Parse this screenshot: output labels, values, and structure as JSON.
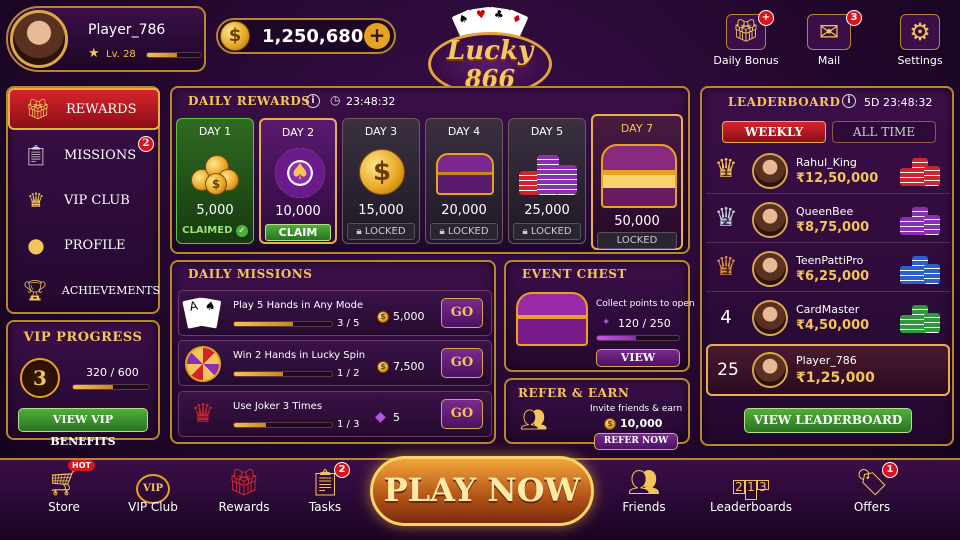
{
  "player": {
    "name": "Player_786",
    "level": "Lv. 28",
    "level_progress": 0.55
  },
  "balance": {
    "amount": "1,250,680",
    "add_label": "+"
  },
  "logo": {
    "line1": "Lucky",
    "line2": "866"
  },
  "top_actions": [
    {
      "label": "Daily Bonus",
      "icon": "gift-icon",
      "badge": "+"
    },
    {
      "label": "Mail",
      "icon": "mail-icon",
      "badge": "3"
    },
    {
      "label": "Settings",
      "icon": "gear-icon",
      "badge": ""
    }
  ],
  "sidebar": {
    "items": [
      {
        "label": "REWARDS",
        "icon": "gift-icon",
        "active": true,
        "badge": ""
      },
      {
        "label": "MISSIONS",
        "icon": "clipboard-icon",
        "active": false,
        "badge": "2"
      },
      {
        "label": "VIP CLUB",
        "icon": "crown-icon",
        "active": false,
        "badge": ""
      },
      {
        "label": "PROFILE",
        "icon": "person-icon",
        "active": false,
        "badge": ""
      },
      {
        "label": "ACHIEVEMENTS",
        "icon": "trophy-icon",
        "active": false,
        "badge": ""
      }
    ]
  },
  "vip": {
    "title": "VIP PROGRESS",
    "level": "3",
    "progress_text": "320 / 600",
    "progress": 0.53,
    "button": "VIEW VIP BENEFITS"
  },
  "daily_rewards": {
    "title": "DAILY REWARDS",
    "timer": "23:48:32",
    "days": [
      {
        "label": "DAY 1",
        "amount": "5,000",
        "status": "CLAIMED",
        "state": "claimed"
      },
      {
        "label": "DAY 2",
        "amount": "10,000",
        "status": "CLAIM",
        "state": "claim"
      },
      {
        "label": "DAY 3",
        "amount": "15,000",
        "status": "LOCKED",
        "state": "locked"
      },
      {
        "label": "DAY 4",
        "amount": "20,000",
        "status": "LOCKED",
        "state": "locked"
      },
      {
        "label": "DAY 5",
        "amount": "25,000",
        "status": "LOCKED",
        "state": "locked"
      },
      {
        "label": "DAY 7",
        "amount": "50,000",
        "status": "LOCKED",
        "state": "big"
      }
    ]
  },
  "daily_missions": {
    "title": "DAILY MISSIONS",
    "items": [
      {
        "title": "Play 5 Hands in Any Mode",
        "progress": "3 / 5",
        "progress_frac": 0.6,
        "reward": "5,000",
        "reward_type": "coin",
        "button": "GO"
      },
      {
        "title": "Win 2 Hands in Lucky Spin",
        "progress": "1 / 2",
        "progress_frac": 0.5,
        "reward": "7,500",
        "reward_type": "coin",
        "button": "GO"
      },
      {
        "title": "Use Joker 3 Times",
        "progress": "1 / 3",
        "progress_frac": 0.33,
        "reward": "5",
        "reward_type": "gem",
        "button": "GO"
      }
    ]
  },
  "event_chest": {
    "title": "EVENT CHEST",
    "desc": "Collect points to open",
    "progress_text": "120 / 250",
    "progress": 0.48,
    "button": "VIEW"
  },
  "refer": {
    "title": "REFER & EARN",
    "desc": "Invite friends & earn",
    "reward": "10,000",
    "button": "REFER NOW"
  },
  "leaderboard": {
    "title": "LEADERBOARD",
    "timer": "5D 23:48:32",
    "tabs": [
      "WEEKLY",
      "ALL TIME"
    ],
    "rows": [
      {
        "rank": "1",
        "name": "Rahul_King",
        "amount": "₹12,50,000",
        "chip_color": "#d0242c"
      },
      {
        "rank": "2",
        "name": "QueenBee",
        "amount": "₹8,75,000",
        "chip_color": "#8a2fb0"
      },
      {
        "rank": "3",
        "name": "TeenPattiPro",
        "amount": "₹6,25,000",
        "chip_color": "#2a5fd0"
      },
      {
        "rank": "4",
        "name": "CardMaster",
        "amount": "₹4,50,000",
        "chip_color": "#2f9a3a"
      }
    ],
    "me": {
      "rank": "25",
      "name": "Player_786",
      "amount": "₹1,25,000"
    },
    "button": "VIEW LEADERBOARD"
  },
  "bottom_nav": {
    "items": [
      {
        "label": "Store",
        "icon": "cart-icon",
        "badge": "HOT"
      },
      {
        "label": "VIP Club",
        "icon": "vip-icon",
        "badge": ""
      },
      {
        "label": "Rewards",
        "icon": "gift-icon",
        "badge": ""
      },
      {
        "label": "Tasks",
        "icon": "tasks-icon",
        "badge": "2"
      },
      {
        "label": "Friends",
        "icon": "friends-icon",
        "badge": ""
      },
      {
        "label": "Leaderboards",
        "icon": "podium-icon",
        "badge": ""
      },
      {
        "label": "Offers",
        "icon": "tag-icon",
        "badge": "1"
      }
    ],
    "play_now": "PLAY NOW"
  }
}
